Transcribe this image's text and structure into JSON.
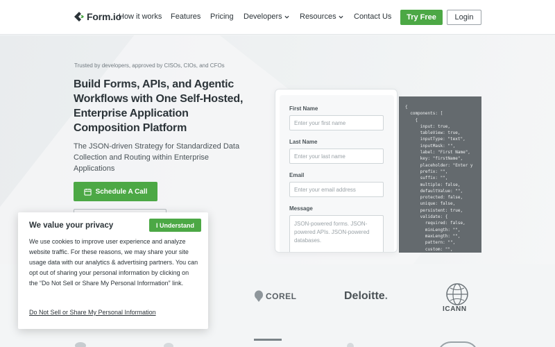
{
  "header": {
    "logo_text": "Form.io",
    "nav": [
      {
        "label": "How it works",
        "has_dropdown": false
      },
      {
        "label": "Features",
        "has_dropdown": false
      },
      {
        "label": "Pricing",
        "has_dropdown": false
      },
      {
        "label": "Developers",
        "has_dropdown": true
      },
      {
        "label": "Resources",
        "has_dropdown": true
      },
      {
        "label": "Contact Us",
        "has_dropdown": false
      }
    ],
    "try_free_label": "Try Free",
    "login_label": "Login"
  },
  "hero": {
    "trusted": "Trusted by developers, approved by CISOs, CIOs, and CFOs",
    "headline": "Build Forms, APIs, and Agentic Workflows with One Self-Hosted, Enterprise Application Composition Platform",
    "subhead": "The JSON-driven Strategy for Standardized Data Collection and Routing within Enterprise Applications",
    "schedule_label": "Schedule A Call"
  },
  "form_demo": {
    "first_name_label": "First Name",
    "first_name_placeholder": "Enter your first name",
    "last_name_label": "Last Name",
    "last_name_placeholder": "Enter your last name",
    "email_label": "Email",
    "email_placeholder": "Enter your email address",
    "message_label": "Message",
    "message_placeholder": "JSON-powered forms. JSON-powered APIs. JSON-powered databases."
  },
  "code_sample": "{\n  components: [\n    {\n      input: true,\n      tableView: true,\n      inputType: \"text\",\n      inputMask: \"\",\n      label: \"First Name\",\n      key: \"firstName\",\n      placeholder: \"Enter y\n      prefix: \"\",\n      suffix: \"\",\n      multiple: false,\n      defaultValue: \"\",\n      protected: false,\n      unique: false,\n      persistent: true,\n      validate: {\n        required: false,\n        minLength: \"\",\n        maxLength: \"\",\n        pattern: \"\",\n        custom: \"\",",
  "logos": {
    "corel": "COREL",
    "deloitte": "Deloitte",
    "deloitte_dot": ".",
    "icann": "ICANN"
  },
  "privacy": {
    "title": "We value your privacy",
    "understand_label": "I Understand",
    "body": "We use cookies to improve user experience and analyze website traffic. For these reasons, we may share your site usage data with our analytics & advertising partners. You can opt out of sharing your personal information by clicking on the “Do Not Sell or Share My Personal Information” link.",
    "link_label": "Do Not Sell or Share My Personal Information"
  },
  "colors": {
    "brand_green": "#4ca845",
    "text_dark": "#2b3338",
    "code_bg": "#646a6e"
  }
}
